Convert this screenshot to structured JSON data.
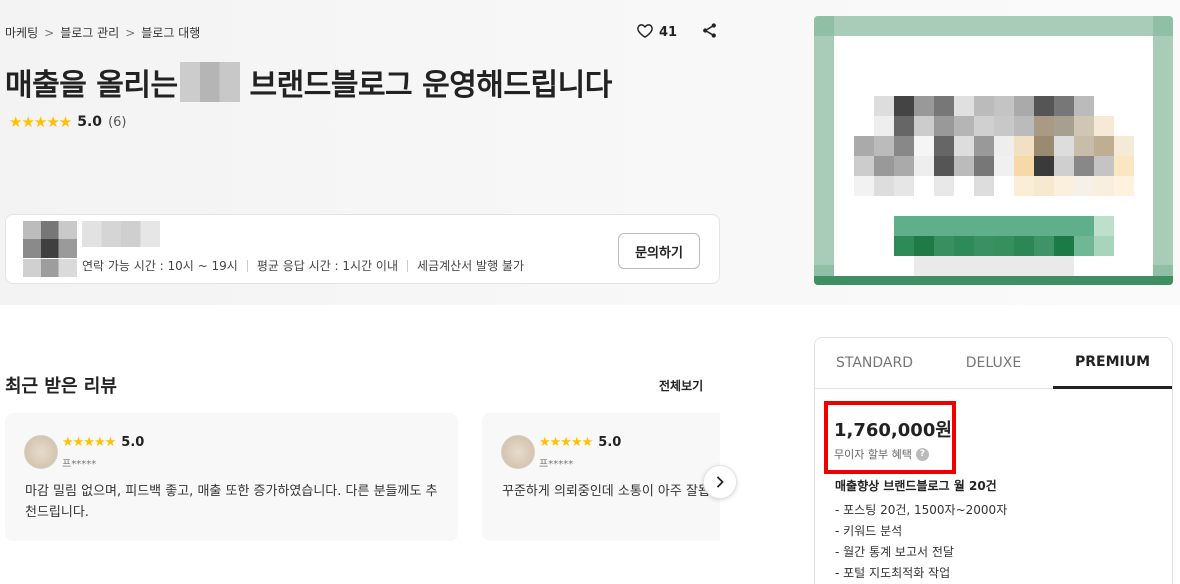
{
  "breadcrumb": [
    "마케팅",
    "블로그 관리",
    "블로그 대행"
  ],
  "likes": {
    "count": "41"
  },
  "title": {
    "before": "매출을 올리는",
    "after": "브랜드블로그 운영해드립니다"
  },
  "rating": {
    "stars": "★★★★★",
    "score": "5.0",
    "count": "(6)"
  },
  "seller": {
    "contact_hours": "연락 가능 시간 : 10시 ~ 19시",
    "response_time": "평균 응답 시간 : 1시간 이내",
    "tax_invoice": "세금계산서 발행 불가",
    "inquiry_label": "문의하기"
  },
  "reviews": {
    "title": "최근 받은 리뷰",
    "see_all": "전체보기",
    "items": [
      {
        "stars": "★★★★★",
        "score": "5.0",
        "user": "프*****",
        "text": "마감 밀림 없으며, 피드백 좋고, 매출 또한 증가하였습니다. 다른 분들께도 추천드립니다."
      },
      {
        "stars": "★★★★★",
        "score": "5.0",
        "user": "프*****",
        "text": "꾸준하게 의뢰중인데 소통이 아주 잘됩니다"
      }
    ]
  },
  "package": {
    "tabs": [
      "STANDARD",
      "DELUXE",
      "PREMIUM"
    ],
    "active_tab": "PREMIUM",
    "price": "1,760,000원",
    "installment": "무이자 할부 혜택",
    "title": "매출향상 브랜드블로그 월 20건",
    "features": [
      "- 포스팅 20건, 1500자~2000자",
      "- 키워드 분석",
      "- 월간 통계 보고서 전달",
      "- 포털 지도최적화 작업"
    ]
  },
  "icons": {
    "like": "heart-icon",
    "share": "share-icon",
    "next": "chevron-right-icon",
    "help": "question-icon"
  },
  "colors": {
    "star": "#ffc107",
    "highlight": "#ee0000",
    "thumb_green": "#2e8b57"
  }
}
